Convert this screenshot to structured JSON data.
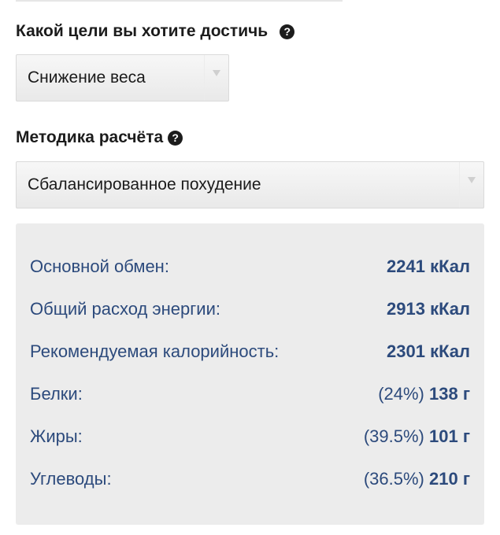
{
  "goal": {
    "label": "Какой цели вы хотите достичь",
    "help_glyph": "?",
    "selected": "Снижение веса"
  },
  "method": {
    "label": "Методика расчёта",
    "help_glyph": "?",
    "selected": "Сбалансированное похудение"
  },
  "results": {
    "bmr": {
      "label": "Основной обмен:",
      "value": "2241 кКал"
    },
    "total": {
      "label": "Общий расход энергии:",
      "value": "2913 кКал"
    },
    "recommended": {
      "label": "Рекомендуемая калорийность:",
      "value": "2301 кКал"
    },
    "protein": {
      "label": "Белки:",
      "percent": "(24%)",
      "amount": "138 г"
    },
    "fat": {
      "label": "Жиры:",
      "percent": "(39.5%)",
      "amount": "101 г"
    },
    "carbs": {
      "label": "Углеводы:",
      "percent": "(36.5%)",
      "amount": "210 г"
    }
  },
  "colors": {
    "result_text": "#2c4a7c",
    "panel_background": "#ececec",
    "label_text": "#1c1c1c"
  },
  "icons": {
    "help": "question-circle-icon",
    "dropdown": "chevron-down-icon"
  }
}
